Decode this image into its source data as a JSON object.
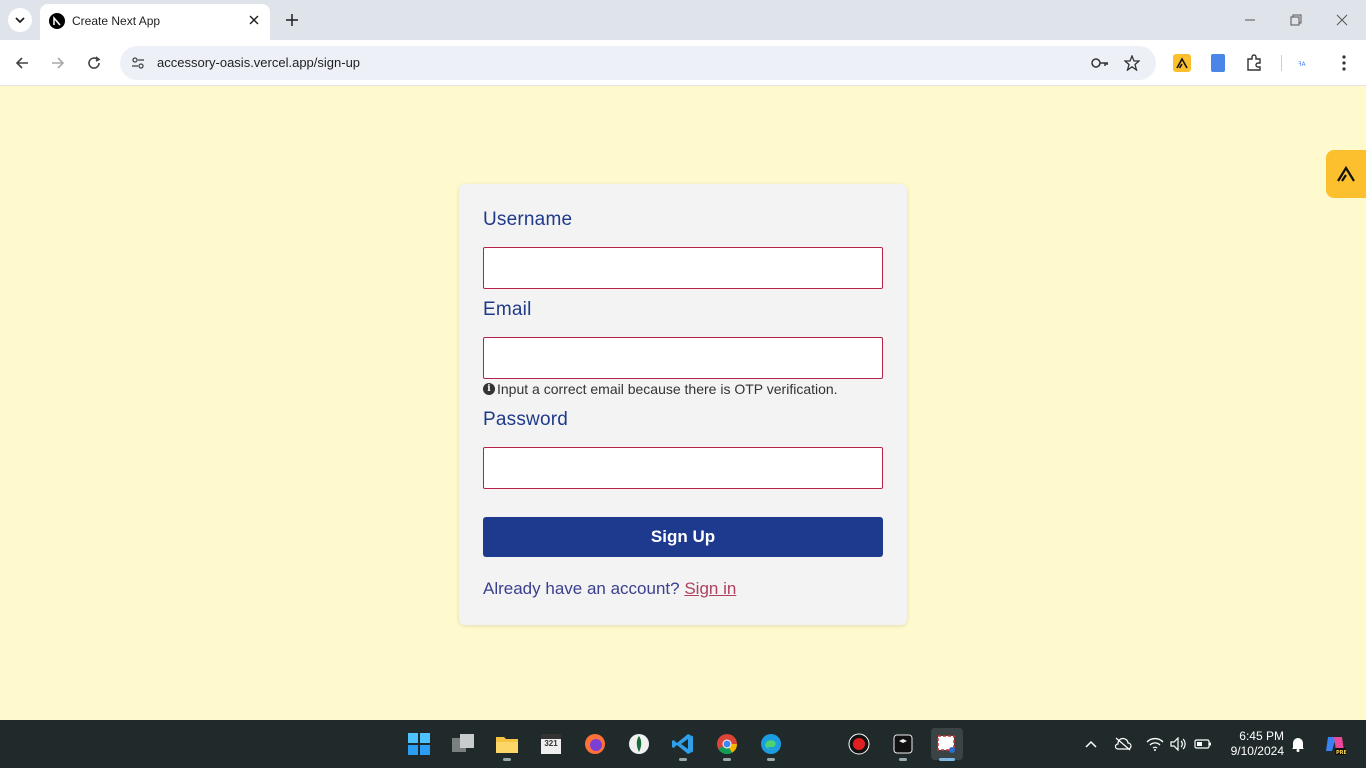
{
  "browser": {
    "tab_title": "Create Next App",
    "url": "accessory-oasis.vercel.app/sign-up"
  },
  "form": {
    "username_label": "Username",
    "email_label": "Email",
    "email_hint": "Input a correct email because there is OTP verification.",
    "password_label": "Password",
    "signup_button": "Sign Up",
    "account_prompt": "Already have an account?",
    "signin_link": "Sign in"
  },
  "taskbar": {
    "time": "6:45 PM",
    "date": "9/10/2024"
  },
  "colors": {
    "page_background": "#fefacd",
    "primary": "#1e3a8f",
    "input_border": "#b4224a",
    "link": "#b04060",
    "widget": "#fcc02f"
  },
  "icons": [
    "tab-search-icon",
    "nextjs-favicon-icon",
    "close-icon",
    "plus-icon",
    "minimize-icon",
    "restore-icon",
    "back-icon",
    "forward-icon",
    "reload-icon",
    "site-info-icon",
    "key-icon",
    "star-icon",
    "extension-icon",
    "puzzle-icon",
    "menu-icon",
    "info-icon",
    "windows-start-icon",
    "wifi-icon",
    "volume-icon",
    "battery-icon",
    "bell-icon"
  ]
}
